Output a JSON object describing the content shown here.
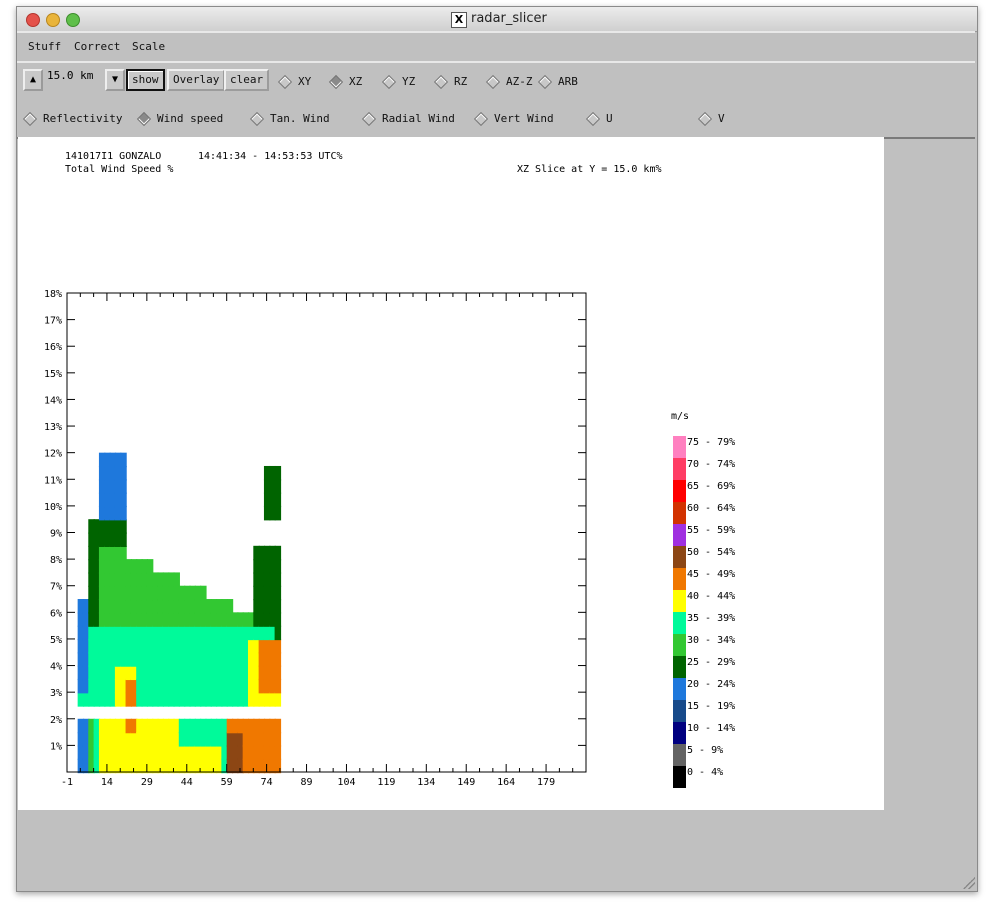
{
  "window": {
    "title": "radar_slicer"
  },
  "menu": [
    "Stuff",
    "Correct",
    "Scale"
  ],
  "toolbar": {
    "km_value": "15.0 km",
    "show_label": "show",
    "overlay_label": "Overlay",
    "clear_label": "clear",
    "slice_options": [
      "XY",
      "XZ",
      "YZ",
      "RZ",
      "AZ-Z",
      "ARB"
    ],
    "selected_slice": "XZ",
    "field_options": [
      "Reflectivity",
      "Wind speed",
      "Tan. Wind",
      "Radial Wind",
      "Vert Wind",
      "U",
      "V"
    ],
    "selected_field": "Wind speed"
  },
  "plot_info": {
    "storm": "141017I1 GONZALO",
    "time_range": "14:41:34 - 14:53:53 UTC%",
    "field_title": "Total Wind Speed %",
    "slice_title": "XZ Slice at Y = 15.0 km%"
  },
  "chart_data": {
    "type": "heatmap",
    "x_tick_labels": [
      "-1",
      "14",
      "29",
      "44",
      "59",
      "74",
      "89",
      "104",
      "119",
      "134",
      "149",
      "164",
      "179"
    ],
    "y_tick_labels": [
      "1%",
      "2%",
      "3%",
      "4%",
      "5%",
      "6%",
      "7%",
      "8%",
      "9%",
      "10%",
      "11%",
      "12%",
      "13%",
      "14%",
      "15%",
      "16%",
      "17%",
      "18%"
    ],
    "xlim": [
      -1,
      194
    ],
    "ylim": [
      0,
      18
    ],
    "legend_unit": "m/s",
    "legend": [
      {
        "label": "75 - 79%",
        "color": "#ff80c0"
      },
      {
        "label": "70 - 74%",
        "color": "#ff3c64"
      },
      {
        "label": "65 - 69%",
        "color": "#ff0000"
      },
      {
        "label": "60 - 64%",
        "color": "#d23200"
      },
      {
        "label": "55 - 59%",
        "color": "#a030e0"
      },
      {
        "label": "50 - 54%",
        "color": "#8c4614"
      },
      {
        "label": "45 - 49%",
        "color": "#f07800"
      },
      {
        "label": "40 - 44%",
        "color": "#ffff00"
      },
      {
        "label": "35 - 39%",
        "color": "#00fa9a"
      },
      {
        "label": "30 - 34%",
        "color": "#32c832"
      },
      {
        "label": "25 - 29%",
        "color": "#006400"
      },
      {
        "label": "20 - 24%",
        "color": "#1e78dc"
      },
      {
        "label": "15 - 19%",
        "color": "#174a8a"
      },
      {
        "label": "10 - 14%",
        "color": "#000080"
      },
      {
        "label": "5 - 9%",
        "color": "#646464"
      },
      {
        "label": "0 - 4%",
        "color": "#000000"
      }
    ]
  }
}
